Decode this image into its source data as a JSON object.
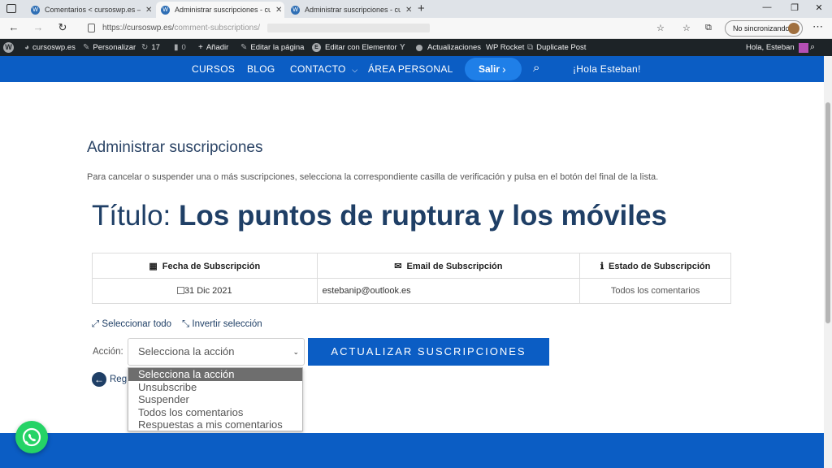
{
  "browser": {
    "tabs": [
      {
        "title": "Comentarios < cursoswp.es — V"
      },
      {
        "title": "Administrar suscripciones - curs"
      },
      {
        "title": "Administrar suscripciones - curs"
      }
    ],
    "url_prefix": "https://cursoswp.es/",
    "url_path": "comment-subscriptions/",
    "sync_label": "No sincronizando"
  },
  "adminbar": {
    "site": "cursoswp.es",
    "customize": "Personalizar",
    "updates_count": "17",
    "comments_count": "0",
    "new": "Añadir",
    "edit_page": "Editar la página",
    "edit_elementor": "Editar con Elementor",
    "updates": "Actualizaciones",
    "wp_rocket": "WP Rocket",
    "duplicate": "Duplicate Post",
    "greeting": "Hola, Esteban"
  },
  "nav": {
    "items": [
      "CURSOS",
      "BLOG",
      "CONTACTO",
      "ÁREA PERSONAL"
    ],
    "logout": "Salir",
    "hello": "¡Hola Esteban!"
  },
  "page": {
    "heading": "Administrar suscripciones",
    "intro": "Para cancelar o suspender una o más suscripciones, selecciona la correspondiente casilla de verificación y pulsa en el botón del final de la lista.",
    "title_prefix": "Título:",
    "title_post": "Los puntos de ruptura y los móviles"
  },
  "table": {
    "headers": [
      "Fecha de Subscripción",
      "Email de Subscripción",
      "Estado de Subscripción"
    ],
    "rows": [
      {
        "date": "31 Dic 2021",
        "email": "estebanip@outlook.es",
        "status": "Todos los comentarios"
      }
    ]
  },
  "actions": {
    "select_all": "Seleccionar todo",
    "invert": "Invertir selección",
    "label": "Acción:",
    "selected": "Selecciona la acción",
    "options": [
      "Selecciona la acción",
      "Unsubscribe",
      "Suspender",
      "Todos los comentarios",
      "Respuestas a mis comentarios"
    ],
    "update_button": "ACTUALIZAR SUSCRIPCIONES",
    "back": "Reg"
  },
  "colors": {
    "brand_blue": "#0b5dc4",
    "heading_navy": "#1f3f66",
    "admin_bar": "#1d2327",
    "whatsapp": "#25d366"
  }
}
